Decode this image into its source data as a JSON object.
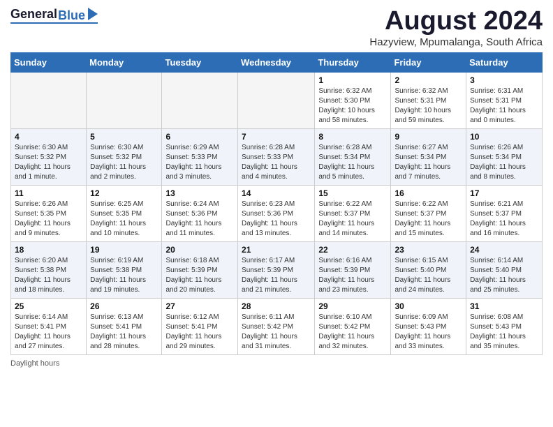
{
  "header": {
    "logo_general": "General",
    "logo_blue": "Blue",
    "month_title": "August 2024",
    "location": "Hazyview, Mpumalanga, South Africa"
  },
  "days_of_week": [
    "Sunday",
    "Monday",
    "Tuesday",
    "Wednesday",
    "Thursday",
    "Friday",
    "Saturday"
  ],
  "footer": {
    "daylight_label": "Daylight hours"
  },
  "weeks": [
    [
      {
        "day": "",
        "info": ""
      },
      {
        "day": "",
        "info": ""
      },
      {
        "day": "",
        "info": ""
      },
      {
        "day": "",
        "info": ""
      },
      {
        "day": "1",
        "info": "Sunrise: 6:32 AM\nSunset: 5:30 PM\nDaylight: 10 hours\nand 58 minutes."
      },
      {
        "day": "2",
        "info": "Sunrise: 6:32 AM\nSunset: 5:31 PM\nDaylight: 10 hours\nand 59 minutes."
      },
      {
        "day": "3",
        "info": "Sunrise: 6:31 AM\nSunset: 5:31 PM\nDaylight: 11 hours\nand 0 minutes."
      }
    ],
    [
      {
        "day": "4",
        "info": "Sunrise: 6:30 AM\nSunset: 5:32 PM\nDaylight: 11 hours\nand 1 minute."
      },
      {
        "day": "5",
        "info": "Sunrise: 6:30 AM\nSunset: 5:32 PM\nDaylight: 11 hours\nand 2 minutes."
      },
      {
        "day": "6",
        "info": "Sunrise: 6:29 AM\nSunset: 5:33 PM\nDaylight: 11 hours\nand 3 minutes."
      },
      {
        "day": "7",
        "info": "Sunrise: 6:28 AM\nSunset: 5:33 PM\nDaylight: 11 hours\nand 4 minutes."
      },
      {
        "day": "8",
        "info": "Sunrise: 6:28 AM\nSunset: 5:34 PM\nDaylight: 11 hours\nand 5 minutes."
      },
      {
        "day": "9",
        "info": "Sunrise: 6:27 AM\nSunset: 5:34 PM\nDaylight: 11 hours\nand 7 minutes."
      },
      {
        "day": "10",
        "info": "Sunrise: 6:26 AM\nSunset: 5:34 PM\nDaylight: 11 hours\nand 8 minutes."
      }
    ],
    [
      {
        "day": "11",
        "info": "Sunrise: 6:26 AM\nSunset: 5:35 PM\nDaylight: 11 hours\nand 9 minutes."
      },
      {
        "day": "12",
        "info": "Sunrise: 6:25 AM\nSunset: 5:35 PM\nDaylight: 11 hours\nand 10 minutes."
      },
      {
        "day": "13",
        "info": "Sunrise: 6:24 AM\nSunset: 5:36 PM\nDaylight: 11 hours\nand 11 minutes."
      },
      {
        "day": "14",
        "info": "Sunrise: 6:23 AM\nSunset: 5:36 PM\nDaylight: 11 hours\nand 13 minutes."
      },
      {
        "day": "15",
        "info": "Sunrise: 6:22 AM\nSunset: 5:37 PM\nDaylight: 11 hours\nand 14 minutes."
      },
      {
        "day": "16",
        "info": "Sunrise: 6:22 AM\nSunset: 5:37 PM\nDaylight: 11 hours\nand 15 minutes."
      },
      {
        "day": "17",
        "info": "Sunrise: 6:21 AM\nSunset: 5:37 PM\nDaylight: 11 hours\nand 16 minutes."
      }
    ],
    [
      {
        "day": "18",
        "info": "Sunrise: 6:20 AM\nSunset: 5:38 PM\nDaylight: 11 hours\nand 18 minutes."
      },
      {
        "day": "19",
        "info": "Sunrise: 6:19 AM\nSunset: 5:38 PM\nDaylight: 11 hours\nand 19 minutes."
      },
      {
        "day": "20",
        "info": "Sunrise: 6:18 AM\nSunset: 5:39 PM\nDaylight: 11 hours\nand 20 minutes."
      },
      {
        "day": "21",
        "info": "Sunrise: 6:17 AM\nSunset: 5:39 PM\nDaylight: 11 hours\nand 21 minutes."
      },
      {
        "day": "22",
        "info": "Sunrise: 6:16 AM\nSunset: 5:39 PM\nDaylight: 11 hours\nand 23 minutes."
      },
      {
        "day": "23",
        "info": "Sunrise: 6:15 AM\nSunset: 5:40 PM\nDaylight: 11 hours\nand 24 minutes."
      },
      {
        "day": "24",
        "info": "Sunrise: 6:14 AM\nSunset: 5:40 PM\nDaylight: 11 hours\nand 25 minutes."
      }
    ],
    [
      {
        "day": "25",
        "info": "Sunrise: 6:14 AM\nSunset: 5:41 PM\nDaylight: 11 hours\nand 27 minutes."
      },
      {
        "day": "26",
        "info": "Sunrise: 6:13 AM\nSunset: 5:41 PM\nDaylight: 11 hours\nand 28 minutes."
      },
      {
        "day": "27",
        "info": "Sunrise: 6:12 AM\nSunset: 5:41 PM\nDaylight: 11 hours\nand 29 minutes."
      },
      {
        "day": "28",
        "info": "Sunrise: 6:11 AM\nSunset: 5:42 PM\nDaylight: 11 hours\nand 31 minutes."
      },
      {
        "day": "29",
        "info": "Sunrise: 6:10 AM\nSunset: 5:42 PM\nDaylight: 11 hours\nand 32 minutes."
      },
      {
        "day": "30",
        "info": "Sunrise: 6:09 AM\nSunset: 5:43 PM\nDaylight: 11 hours\nand 33 minutes."
      },
      {
        "day": "31",
        "info": "Sunrise: 6:08 AM\nSunset: 5:43 PM\nDaylight: 11 hours\nand 35 minutes."
      }
    ]
  ]
}
